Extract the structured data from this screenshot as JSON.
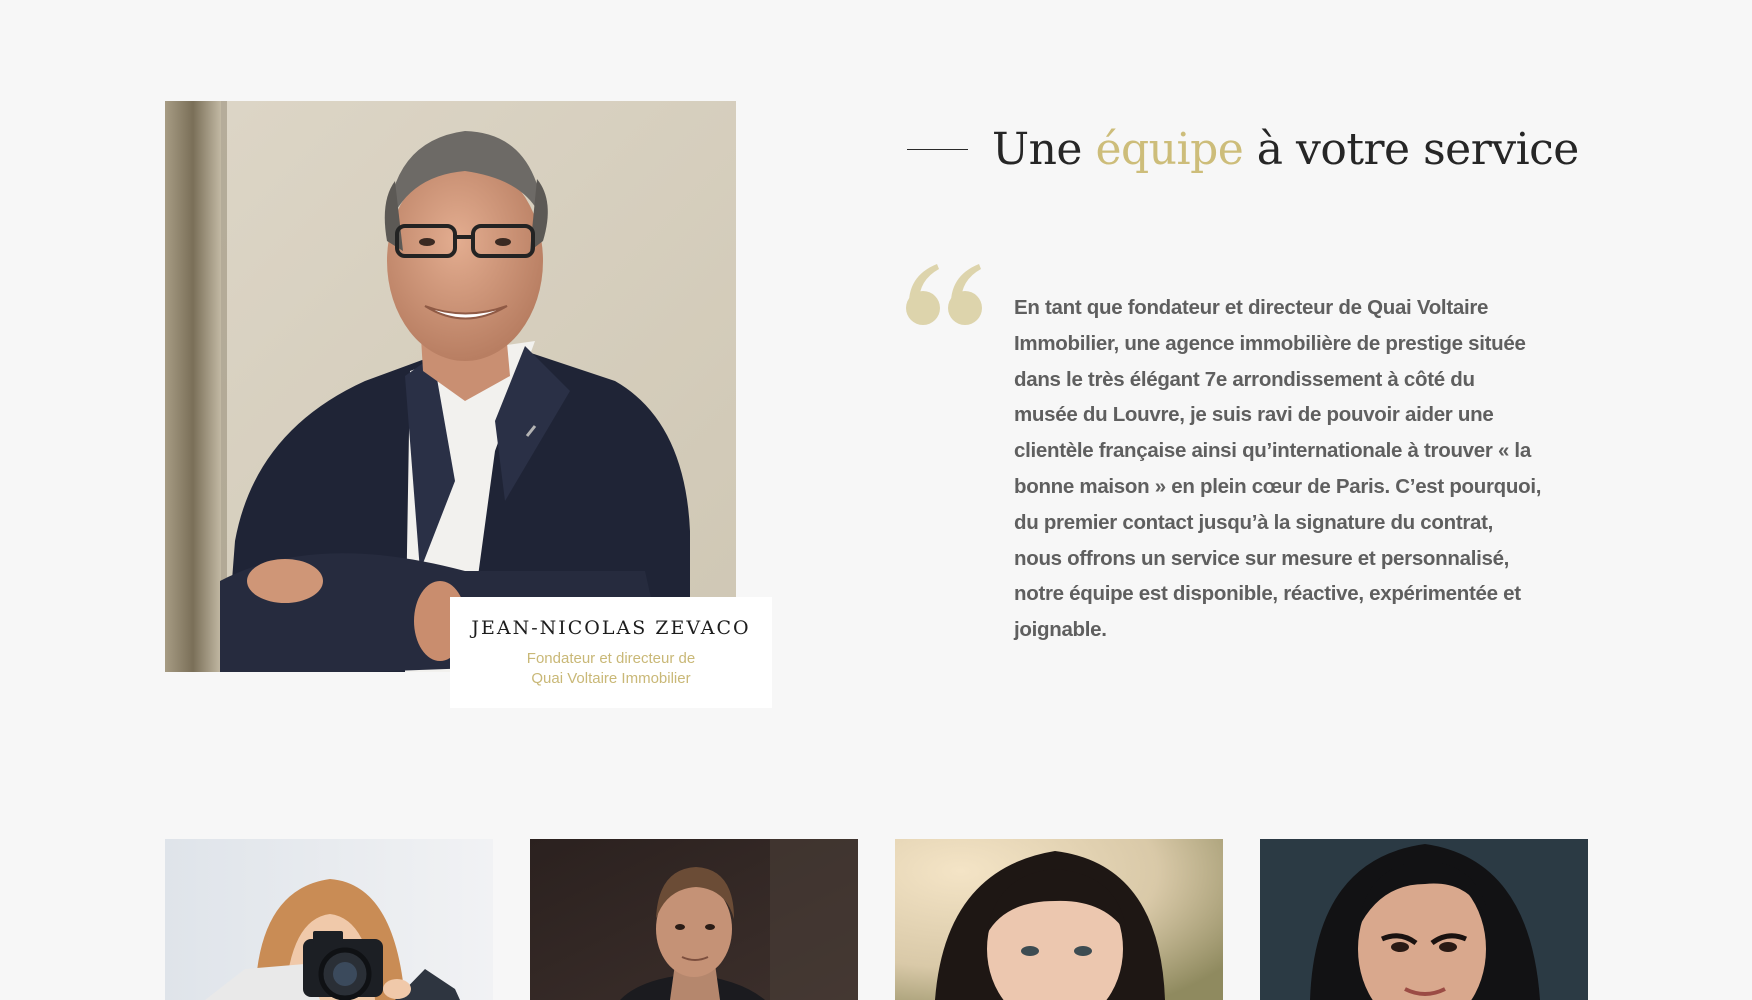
{
  "colors": {
    "background": "#f7f7f7",
    "accent": "#cdbd7a",
    "text": "#5f5f5f",
    "heading": "#262626"
  },
  "founder": {
    "photo": "founder-portrait",
    "name": "JEAN-NICOLAS ZEVACO",
    "role_line1": "Fondateur et directeur de",
    "role_line2": "Quai Voltaire Immobilier"
  },
  "section": {
    "heading_before": "Une ",
    "heading_accent": "équipe",
    "heading_after": " à votre service",
    "quote_icon": "quote-mark-icon",
    "quote": "En tant que fondateur et directeur de Quai Voltaire Immobilier, une agence immobilière de prestige située dans le très élégant 7e arrondissement à côté du musée du Louvre, je suis ravi de pouvoir aider une clientèle française ainsi qu’internationale à trouver « la bonne maison » en plein cœur de Paris. C’est pourquoi, du premier contact jusqu’à la signature du contrat, nous offrons un service sur mesure et personnalisé, notre équipe est disponible, réactive, expérimentée et joignable."
  },
  "team": [
    {
      "photo": "team-photo-photographer"
    },
    {
      "photo": "team-photo-man"
    },
    {
      "photo": "team-photo-woman-bangs"
    },
    {
      "photo": "team-photo-woman-dark-hair"
    }
  ]
}
